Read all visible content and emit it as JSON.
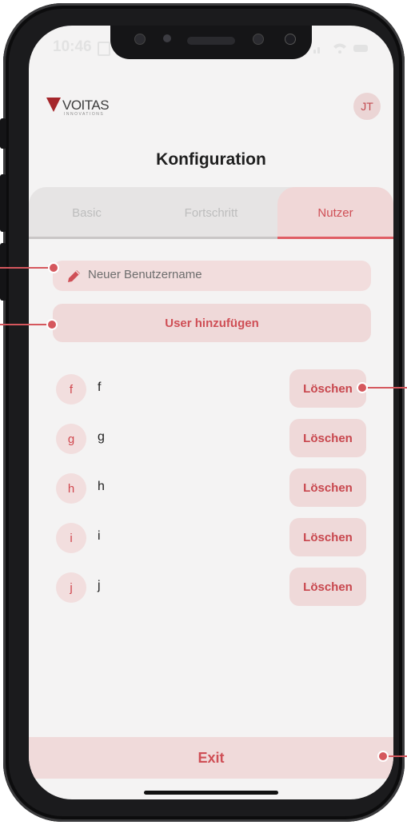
{
  "status_bar": {
    "time": "10:46"
  },
  "header": {
    "logo_text": "VOITAS",
    "logo_subtext": "INNOVATIONS",
    "avatar_initials": "JT"
  },
  "page_title": "Konfiguration",
  "tabs": [
    {
      "label": "Basic",
      "active": false
    },
    {
      "label": "Fortschritt",
      "active": false
    },
    {
      "label": "Nutzer",
      "active": true
    }
  ],
  "username_input": {
    "placeholder": "Neuer Benutzername",
    "value": ""
  },
  "add_user_button": "User hinzufügen",
  "users": [
    {
      "initial": "f",
      "name": "f",
      "delete_label": "Löschen"
    },
    {
      "initial": "g",
      "name": "g",
      "delete_label": "Löschen"
    },
    {
      "initial": "h",
      "name": "h",
      "delete_label": "Löschen"
    },
    {
      "initial": "i",
      "name": "i",
      "delete_label": "Löschen"
    },
    {
      "initial": "j",
      "name": "j",
      "delete_label": "Löschen"
    }
  ],
  "exit_button": "Exit",
  "colors": {
    "accent": "#cf4f56",
    "accent_light": "#f0d9d9",
    "background": "#f4f3f3",
    "brand_logo": "#a5262b"
  },
  "icons": {
    "input": "pencil-icon",
    "logo": "voitas-v-logo"
  }
}
